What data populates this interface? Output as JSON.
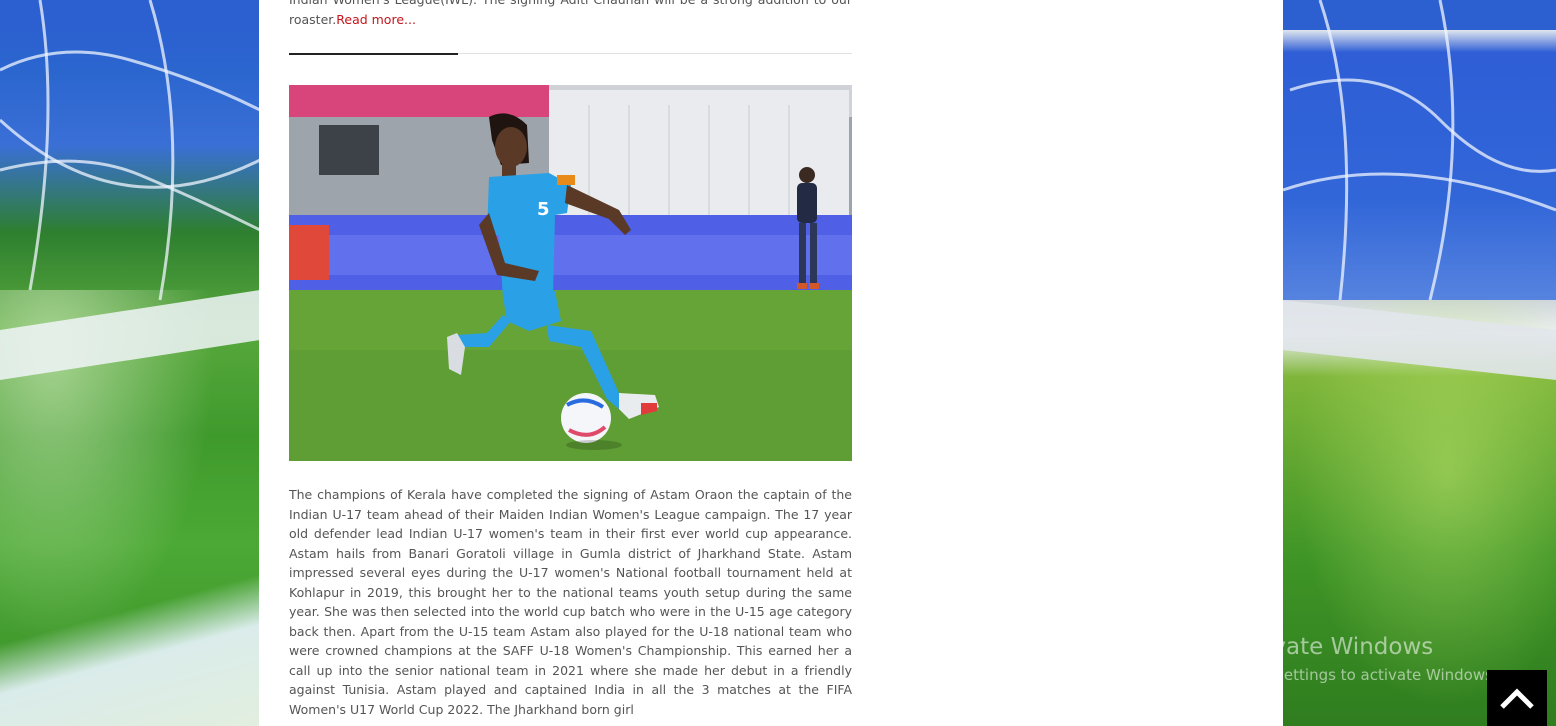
{
  "previous_article": {
    "tail_text": "Indian Women's League(IWL). The signing Aditi Chauhan will be a strong addition to our roaster.",
    "read_more_label": "Read more..."
  },
  "current_article": {
    "image_alt": "Astam Oraon dribbling the ball for India in a blue number 5 jersey",
    "body": "The champions of Kerala have completed the signing of Astam Oraon the captain of the Indian U-17 team ahead of their Maiden Indian Women's League campaign. The 17 year old defender lead Indian U-17 women's team in their first ever world cup appearance. Astam hails from Banari Goratoli village in Gumla district of Jharkhand State. Astam impressed several eyes during the U-17 women's National football tournament held at Kohlapur in 2019, this brought her to the national teams youth setup during the same year. She was then selected into the world cup batch who were in the U-15 age category back then. Apart from the U-15 team Astam also played for the U-18 national team who were crowned champions at the SAFF U-18 Women's Championship. This earned her a call up into the senior national team in 2021 where she made her debut in a friendly against Tunisia. Astam played and captained India in all the 3 matches at the FIFA Women's U17 World Cup 2022. The Jharkhand born girl"
  },
  "photo": {
    "jersey_number": "5"
  },
  "watermark": {
    "title": "Activate Windows",
    "subtitle": "Go to Settings to activate Windows."
  },
  "colors": {
    "accent_read_more": "#c4161c",
    "jersey_blue": "#2aa0e6",
    "scroll_top_bg": "#000000"
  },
  "icons": {
    "scroll_top": "chevron-up-icon"
  }
}
